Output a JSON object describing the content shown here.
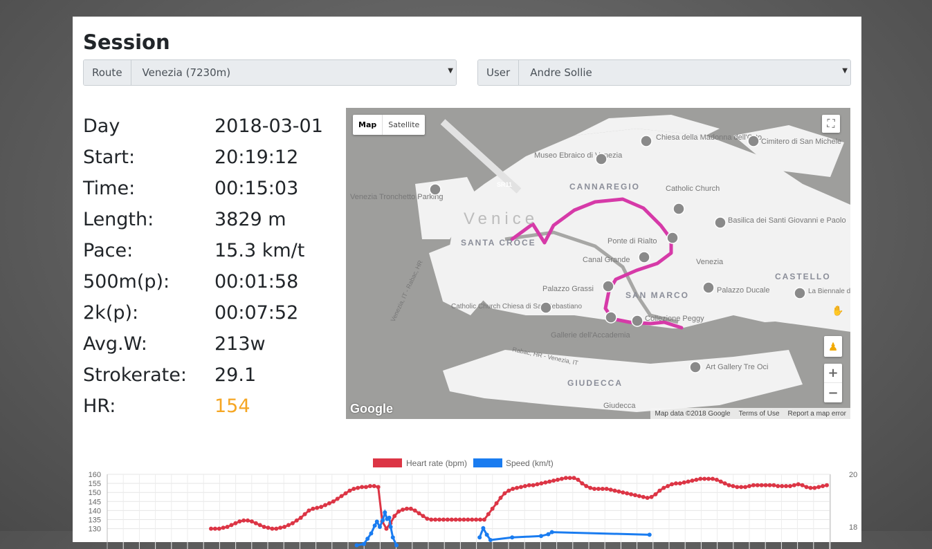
{
  "session": {
    "title": "Session",
    "route_label": "Route",
    "route_value": "Venezia (7230m)",
    "user_label": "User",
    "user_value": "Andre Sollie"
  },
  "stats": [
    {
      "label": "Day",
      "value": "2018-03-01"
    },
    {
      "label": "Start:",
      "value": "20:19:12"
    },
    {
      "label": "Time:",
      "value": "00:15:03"
    },
    {
      "label": "Length:",
      "value": "3829 m"
    },
    {
      "label": "Pace:",
      "value": "15.3 km/t"
    },
    {
      "label": "500m(p):",
      "value": "00:01:58"
    },
    {
      "label": "2k(p):",
      "value": "00:07:52"
    },
    {
      "label": "Avg.W:",
      "value": "213w"
    },
    {
      "label": "Strokerate:",
      "value": "29.1"
    },
    {
      "label": "HR:",
      "value": "154"
    }
  ],
  "map": {
    "type_map": "Map",
    "type_satellite": "Satellite",
    "attribution": "Map data ©2018 Google",
    "terms": "Terms of Use",
    "report": "Report a map error",
    "logo": "Google",
    "route_color": "#d63aa8",
    "labels": [
      "Venice",
      "CANNAREGIO",
      "SANTA CROCE",
      "SAN MARCO",
      "CASTELLO",
      "GIUDECCA",
      "Museo Ebraico di Venezia",
      "Chiesa della Madonna dell'Orto",
      "Cimitero di San Michele",
      "Venezia Tronchetto Parking",
      "Catholic Church",
      "Basilica dei Santi Giovanni e Paolo",
      "Ponte di Rialto",
      "Canal Grande",
      "Venezia",
      "Palazzo Grassi",
      "Palazzo Ducale",
      "Catholic Church Chiesa di San Sebastiano",
      "Gallerie dell'Accademia",
      "Collezione Peggy",
      "La Biennale di Venezia",
      "Art Gallery Tre Oci",
      "Giudecca",
      "SR11",
      "Rabac, HR - Venezia, IT",
      "Venezia, IT - Rabac, HR"
    ]
  },
  "chart_data": {
    "type": "line",
    "legend": [
      {
        "name": "Heart rate (bpm)",
        "color": "#dc3545"
      },
      {
        "name": "Speed (km/t)",
        "color": "#1a7cf0"
      }
    ],
    "y_left_ticks": [
      "160",
      "155",
      "150",
      "145",
      "140",
      "135",
      "130"
    ],
    "y_right_ticks": [
      "20",
      "18"
    ],
    "y_left_range": [
      130,
      160
    ],
    "y_right_range": [
      17.3,
      20
    ],
    "series": [
      {
        "name": "Heart rate (bpm)",
        "color": "#dc3545",
        "values": [
          130,
          130,
          130,
          130.5,
          131,
          132,
          133,
          134,
          134.5,
          134.5,
          134,
          133,
          132,
          131,
          130.5,
          130,
          130,
          130.5,
          131,
          132,
          133,
          134.5,
          136,
          138,
          140,
          141,
          141.5,
          142,
          143,
          144,
          145,
          146.5,
          148,
          149.5,
          151,
          152,
          152.5,
          153,
          153,
          153.5,
          153.5,
          153,
          134,
          130,
          133,
          137,
          139.5,
          140.5,
          141,
          141,
          140,
          138.5,
          137,
          135.5,
          135,
          135,
          135,
          135,
          135,
          135,
          135,
          135,
          135,
          135,
          135,
          135,
          135,
          135,
          138,
          141,
          144,
          147,
          149.5,
          151,
          152,
          152.5,
          153,
          153.5,
          154,
          154,
          154.5,
          155,
          155.5,
          156,
          156.5,
          157,
          157.5,
          158,
          158,
          158,
          157,
          155,
          153.5,
          152.5,
          152,
          152,
          152,
          152,
          151.5,
          151,
          150.5,
          150,
          149.5,
          149,
          148.5,
          148,
          147.5,
          147,
          147.5,
          149,
          151,
          152.5,
          153.5,
          154.5,
          155,
          155,
          155.5,
          156,
          156.5,
          157,
          157.5,
          157.5,
          157.5,
          157.5,
          157,
          156,
          155,
          154,
          153.5,
          153,
          153,
          153,
          153.5,
          154,
          154,
          154,
          154,
          154,
          154,
          153.5,
          153.5,
          153.5,
          153.5,
          154,
          154.5,
          154,
          153,
          152.5,
          152.5,
          153,
          153.5,
          154
        ]
      },
      {
        "name": "Speed (km/t)",
        "color": "#1a7cf0",
        "points": [
          [
            0.345,
            17.3
          ],
          [
            0.355,
            17.35
          ],
          [
            0.36,
            17.55
          ],
          [
            0.365,
            17.75
          ],
          [
            0.37,
            18.05
          ],
          [
            0.373,
            18.2
          ],
          [
            0.377,
            18.0
          ],
          [
            0.381,
            18.25
          ],
          [
            0.384,
            18.55
          ],
          [
            0.387,
            18.3
          ],
          [
            0.39,
            18.35
          ],
          [
            0.392,
            18.0
          ],
          [
            0.395,
            17.6
          ],
          [
            0.4,
            17.3
          ]
        ]
      },
      {
        "name": "Speed (km/t) cont.",
        "color": "#1a7cf0",
        "points": [
          [
            0.515,
            17.6
          ],
          [
            0.52,
            17.95
          ],
          [
            0.525,
            17.7
          ],
          [
            0.53,
            17.5
          ],
          [
            0.56,
            17.6
          ],
          [
            0.6,
            17.65
          ],
          [
            0.61,
            17.72
          ],
          [
            0.615,
            17.8
          ],
          [
            0.75,
            17.7
          ]
        ]
      }
    ]
  }
}
